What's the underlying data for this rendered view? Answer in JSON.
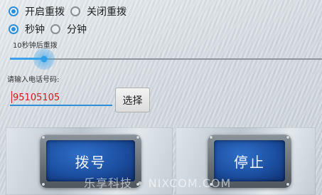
{
  "redial": {
    "on_label": "开启重拨",
    "off_label": "关闭重拨",
    "selected": "on"
  },
  "unit": {
    "seconds_label": "秒钟",
    "minutes_label": "分钟",
    "selected": "seconds"
  },
  "delay": {
    "label": "10秒钟后重拨",
    "slider_fraction": 0.11
  },
  "phone": {
    "prompt": "请输入电话号码:",
    "value": "95105105"
  },
  "select_button_label": "选择",
  "dial_button_label": "拨号",
  "stop_button_label": "停止",
  "watermark": "乐享科技 • NIXCOM.COM",
  "colors": {
    "accent": "#2e8fd8",
    "phone_text": "#d41a1a",
    "button_screen": "#1c4fa0"
  }
}
